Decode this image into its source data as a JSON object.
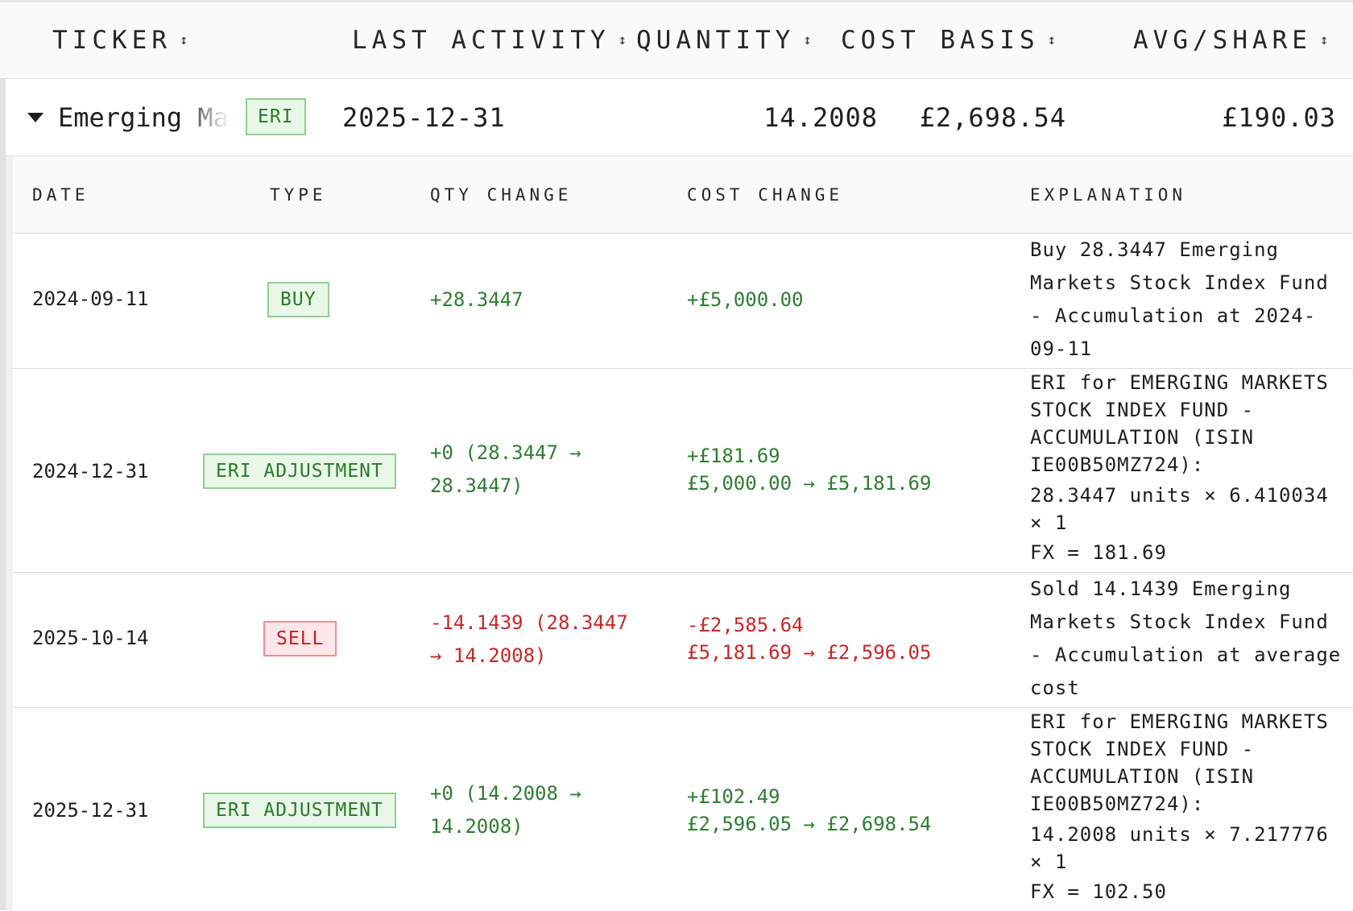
{
  "header": {
    "columns": [
      {
        "label": "TICKER"
      },
      {
        "label": "LAST ACTIVITY"
      },
      {
        "label": "QUANTITY"
      },
      {
        "label": "COST BASIS"
      },
      {
        "label": "AVG/SHARE"
      }
    ],
    "sort_icon": "↕"
  },
  "group": {
    "name": "Emerging Markets Stock Index Fund - Accumulation",
    "badge": "ERI",
    "last_activity": "2025-12-31",
    "quantity": "14.2008",
    "cost_basis": "£2,698.54",
    "avg_share": "£190.03",
    "expanded": true
  },
  "subheader": {
    "columns": [
      {
        "label": "DATE"
      },
      {
        "label": "TYPE"
      },
      {
        "label": "QTY CHANGE"
      },
      {
        "label": "COST CHANGE"
      },
      {
        "label": "EXPLANATION"
      }
    ]
  },
  "colors": {
    "positive": "#2e7d32",
    "negative": "#c62828",
    "badge_green_bg": "#e9f7e9",
    "badge_red_bg": "#fde7e8"
  },
  "transactions": [
    {
      "date": "2024-09-11",
      "type": "BUY",
      "type_color": "green",
      "qty_change": [
        "+28.3447"
      ],
      "cost_change": [
        "+£5,000.00"
      ],
      "explanation": [
        "Buy 28.3447 Emerging",
        "Markets Stock Index Fund",
        "- Accumulation at 2024-",
        "09-11"
      ]
    },
    {
      "date": "2024-12-31",
      "type": "ERI ADJUSTMENT",
      "type_color": "green",
      "qty_change": [
        "+0 (28.3447 →",
        "28.3447)"
      ],
      "cost_change": [
        "+£181.69",
        "£5,000.00 → £5,181.69"
      ],
      "explanation": [
        "ERI for EMERGING MARKETS",
        "STOCK INDEX FUND -",
        "ACCUMULATION (ISIN",
        "IE00B50MZ724):",
        "28.3447 units × 6.410034",
        "× 1",
        "FX = 181.69"
      ]
    },
    {
      "date": "2025-10-14",
      "type": "SELL",
      "type_color": "red",
      "qty_change": [
        "-14.1439 (28.3447",
        "→ 14.2008)"
      ],
      "cost_change": [
        "-£2,585.64",
        "£5,181.69 → £2,596.05"
      ],
      "explanation": [
        "Sold 14.1439 Emerging",
        "Markets Stock Index Fund",
        "- Accumulation at average",
        "cost"
      ]
    },
    {
      "date": "2025-12-31",
      "type": "ERI ADJUSTMENT",
      "type_color": "green",
      "qty_change": [
        "+0 (14.2008 →",
        "14.2008)"
      ],
      "cost_change": [
        "+£102.49",
        "£2,596.05 → £2,698.54"
      ],
      "explanation": [
        "ERI for EMERGING MARKETS",
        "STOCK INDEX FUND -",
        "ACCUMULATION (ISIN",
        "IE00B50MZ724):",
        "14.2008 units × 7.217776",
        "× 1",
        "FX = 102.50"
      ]
    }
  ]
}
